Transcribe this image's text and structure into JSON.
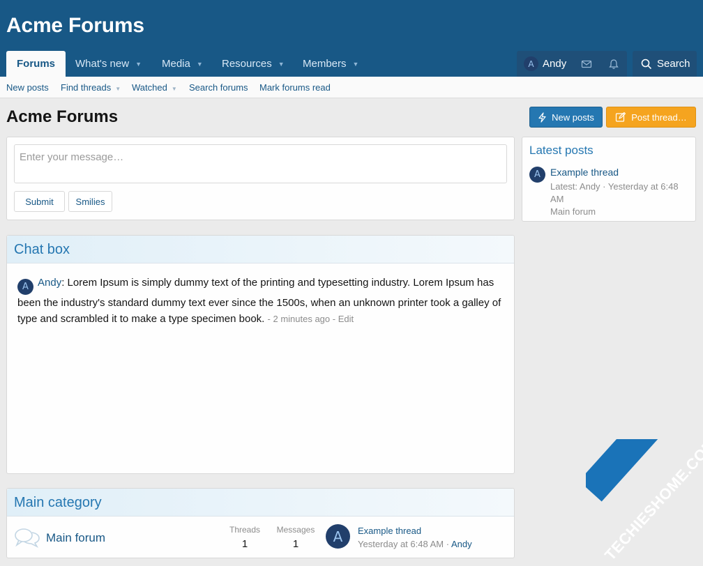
{
  "header": {
    "site_title": "Acme Forums",
    "nav": [
      {
        "label": "Forums",
        "active": true
      },
      {
        "label": "What's new",
        "active": false
      },
      {
        "label": "Media",
        "active": false
      },
      {
        "label": "Resources",
        "active": false
      },
      {
        "label": "Members",
        "active": false
      }
    ],
    "user": {
      "initial": "A",
      "name": "Andy"
    },
    "search_label": "Search",
    "icons": [
      "envelope-icon",
      "bell-icon",
      "search-icon"
    ]
  },
  "subnav": [
    "New posts",
    "Find threads",
    "Watched",
    "Search forums",
    "Mark forums read"
  ],
  "page": {
    "title": "Acme Forums",
    "new_posts_button": "New posts",
    "post_thread_button": "Post thread…"
  },
  "message_box": {
    "placeholder": "Enter your message…",
    "submit": "Submit",
    "smilies": "Smilies"
  },
  "latest_posts": {
    "title": "Latest posts",
    "thread": "Example thread",
    "meta": "Latest: Andy · Yesterday at 6:48 AM",
    "forum": "Main forum",
    "avatar_initial": "A"
  },
  "chat_box": {
    "title": "Chat box",
    "author": "Andy",
    "avatar_initial": "A",
    "message": "Lorem Ipsum is simply dummy text of the printing and typesetting industry. Lorem Ipsum has been the industry's standard dummy text ever since the 1500s, when an unknown printer took a galley of type and scrambled it to make a type specimen book.",
    "meta": "- 2 minutes ago - Edit"
  },
  "category": {
    "title": "Main category",
    "forum_name": "Main forum",
    "threads_label": "Threads",
    "threads_value": "1",
    "messages_label": "Messages",
    "messages_value": "1",
    "avatar_initial": "A",
    "latest_thread": "Example thread",
    "latest_time": "Yesterday at 6:48 AM",
    "latest_user": "Andy"
  },
  "watermark": "TECHIESHOME.COM",
  "colors": {
    "header": "#185886",
    "primary": "#2577b1",
    "accent": "#f5a41f"
  }
}
